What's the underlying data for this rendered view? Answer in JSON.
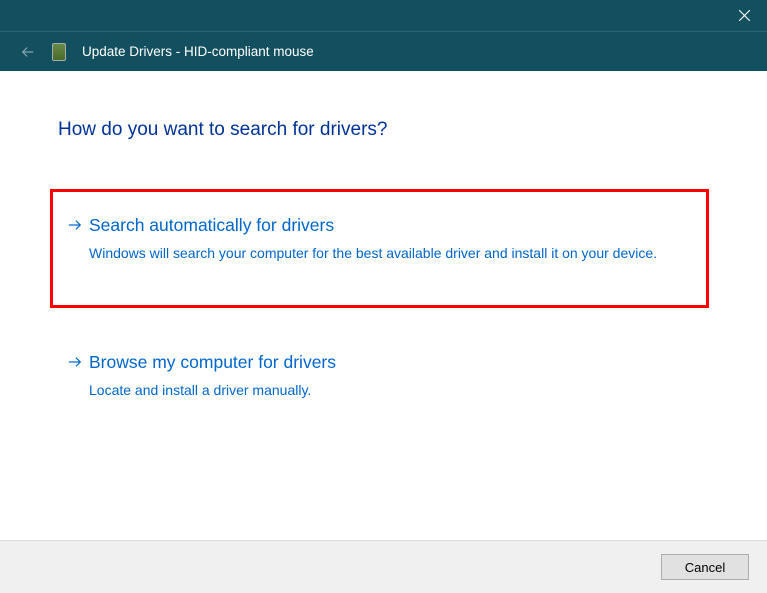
{
  "titlebar": {
    "close_symbol": "close"
  },
  "header": {
    "title": "Update Drivers - HID-compliant mouse"
  },
  "content": {
    "heading": "How do you want to search for drivers?",
    "options": [
      {
        "title": "Search automatically for drivers",
        "description": "Windows will search your computer for the best available driver and install it on your device.",
        "highlighted": true
      },
      {
        "title": "Browse my computer for drivers",
        "description": "Locate and install a driver manually.",
        "highlighted": false
      }
    ]
  },
  "footer": {
    "cancel_label": "Cancel"
  },
  "colors": {
    "titlebar_bg": "#124f5f",
    "link_blue": "#0066cc",
    "heading_blue": "#003399",
    "highlight_red": "#ff0000"
  }
}
